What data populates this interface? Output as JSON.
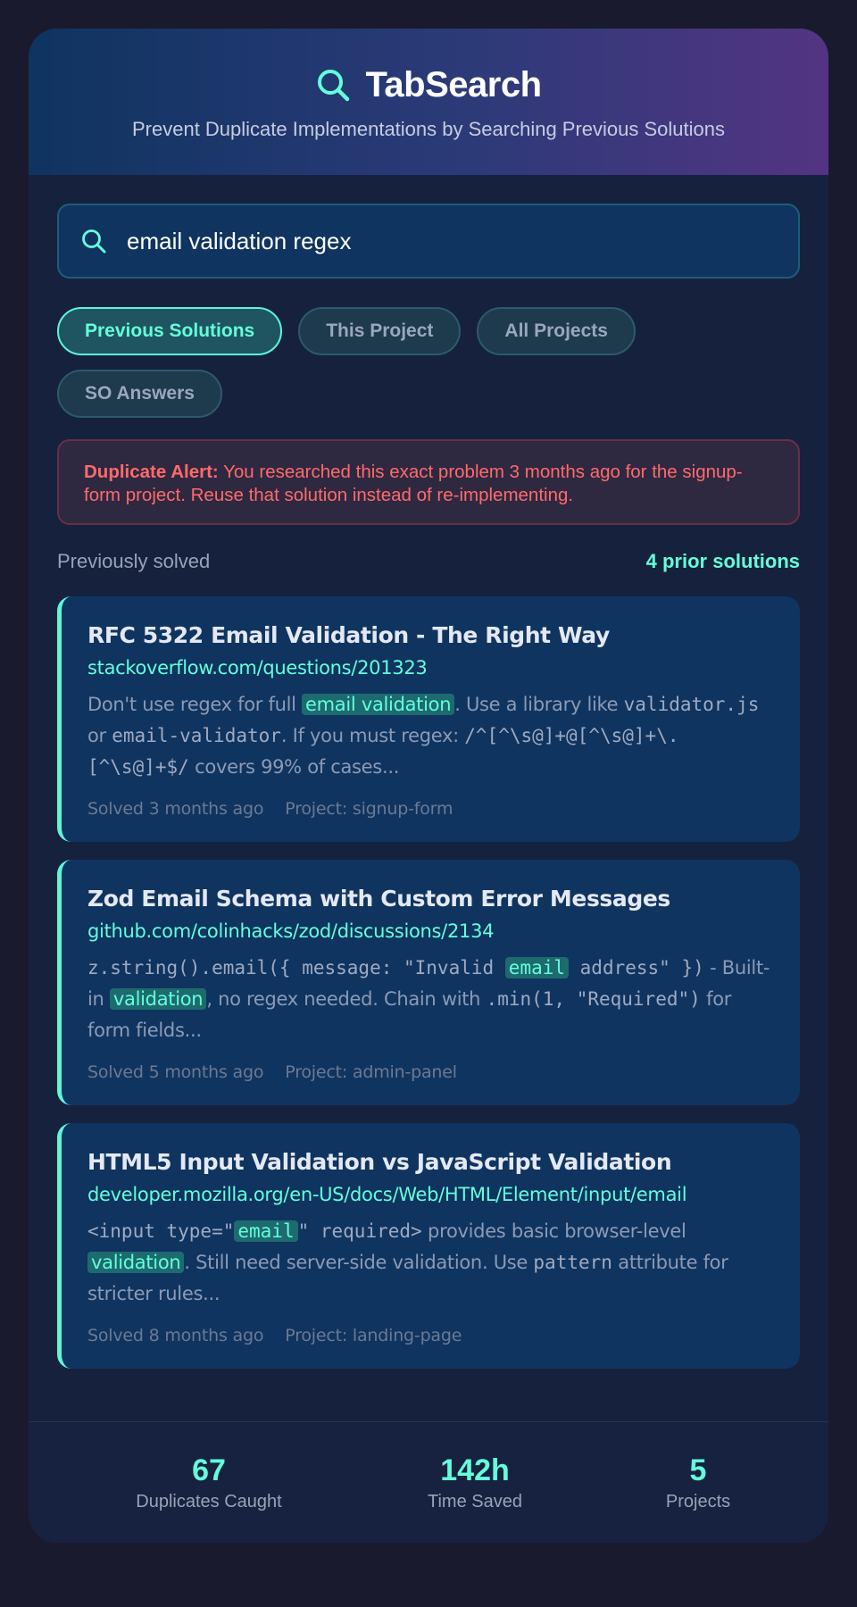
{
  "app": {
    "title": "TabSearch",
    "subtitle": "Prevent Duplicate Implementations by Searching Previous Solutions"
  },
  "search": {
    "value": "email validation regex",
    "placeholder": ""
  },
  "filters": [
    {
      "label": "Previous Solutions",
      "active": true
    },
    {
      "label": "This Project",
      "active": false
    },
    {
      "label": "All Projects",
      "active": false
    },
    {
      "label": "SO Answers",
      "active": false
    }
  ],
  "alert": {
    "label": "Duplicate Alert:",
    "message": "You researched this exact problem 3 months ago for the signup-form project. Reuse that solution instead of re-implementing."
  },
  "results_header": {
    "title": "Previously solved",
    "count": "4 prior solutions"
  },
  "results": [
    {
      "title": "RFC 5322 Email Validation - The Right Way",
      "url": "stackoverflow.com/questions/201323",
      "snippet": [
        {
          "t": "Don't use regex for full "
        },
        {
          "t": "email validation",
          "hl": true
        },
        {
          "t": ". Use a library like "
        },
        {
          "t": "validator.js",
          "code": true
        },
        {
          "t": " or "
        },
        {
          "t": "email-validator",
          "code": true
        },
        {
          "t": ". If you must regex: "
        },
        {
          "t": "/^[^\\s@]+@[^\\s@]+\\.[^\\s@]+$/",
          "code": true
        },
        {
          "t": " covers 99% of cases..."
        }
      ],
      "solved": "Solved 3 months ago",
      "project": "Project: signup-form"
    },
    {
      "title": "Zod Email Schema with Custom Error Messages",
      "url": "github.com/colinhacks/zod/discussions/2134",
      "snippet": [
        {
          "t": "z.string().email({ message: \"Invalid ",
          "code": true
        },
        {
          "t": "email",
          "hl": true,
          "code": true
        },
        {
          "t": " address\" })",
          "code": true
        },
        {
          "t": " - Built-in "
        },
        {
          "t": "validation",
          "hl": true
        },
        {
          "t": ", no regex needed. Chain with "
        },
        {
          "t": ".min(1, \"Required\")",
          "code": true
        },
        {
          "t": " for form fields..."
        }
      ],
      "solved": "Solved 5 months ago",
      "project": "Project: admin-panel"
    },
    {
      "title": "HTML5 Input Validation vs JavaScript Validation",
      "url": "developer.mozilla.org/en-US/docs/Web/HTML/Element/input/email",
      "snippet": [
        {
          "t": "<input type=\"",
          "code": true
        },
        {
          "t": "email",
          "hl": true,
          "code": true
        },
        {
          "t": "\" required>",
          "code": true
        },
        {
          "t": " provides basic browser-level "
        },
        {
          "t": "validation",
          "hl": true
        },
        {
          "t": ". Still need server-side validation. Use "
        },
        {
          "t": "pattern",
          "code": true
        },
        {
          "t": " attribute for stricter rules..."
        }
      ],
      "solved": "Solved 8 months ago",
      "project": "Project: landing-page"
    }
  ],
  "stats": [
    {
      "value": "67",
      "label": "Duplicates Caught"
    },
    {
      "value": "142h",
      "label": "Time Saved"
    },
    {
      "value": "5",
      "label": "Projects"
    }
  ],
  "colors": {
    "accent": "#64ffda",
    "alert": "#ff6b6b",
    "card": "#0f3460",
    "background": "#1a1a2e"
  }
}
